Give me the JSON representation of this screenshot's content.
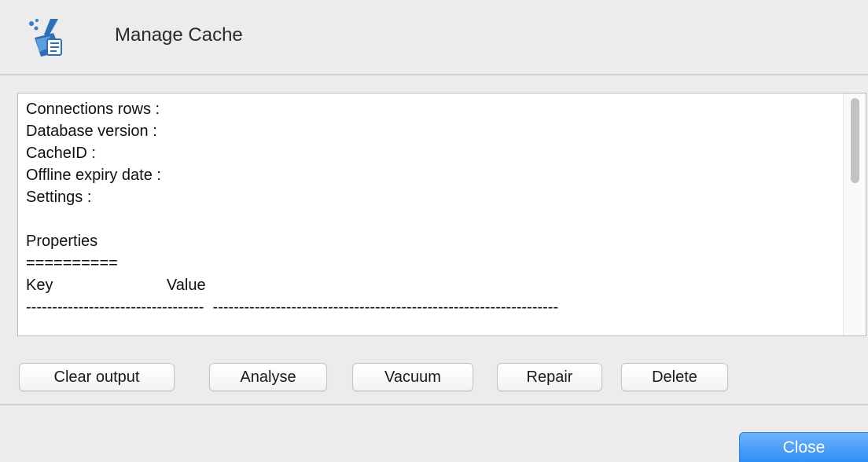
{
  "window": {
    "title": "Manage Cache",
    "icon": "broom-cleanup-icon"
  },
  "output": {
    "text": "Connections rows :\nDatabase version :\nCacheID :\nOffline expiry date :\nSettings :\n\nProperties\n==========\nKey                          Value\n----------------------------------  ------------------------------------------------------------------"
  },
  "buttons": {
    "clear_output": "Clear output",
    "analyse": "Analyse",
    "vacuum": "Vacuum",
    "repair": "Repair",
    "delete": "Delete",
    "close": "Close"
  },
  "colors": {
    "accent": "#2f8ff5",
    "window_bg": "#ececec"
  }
}
